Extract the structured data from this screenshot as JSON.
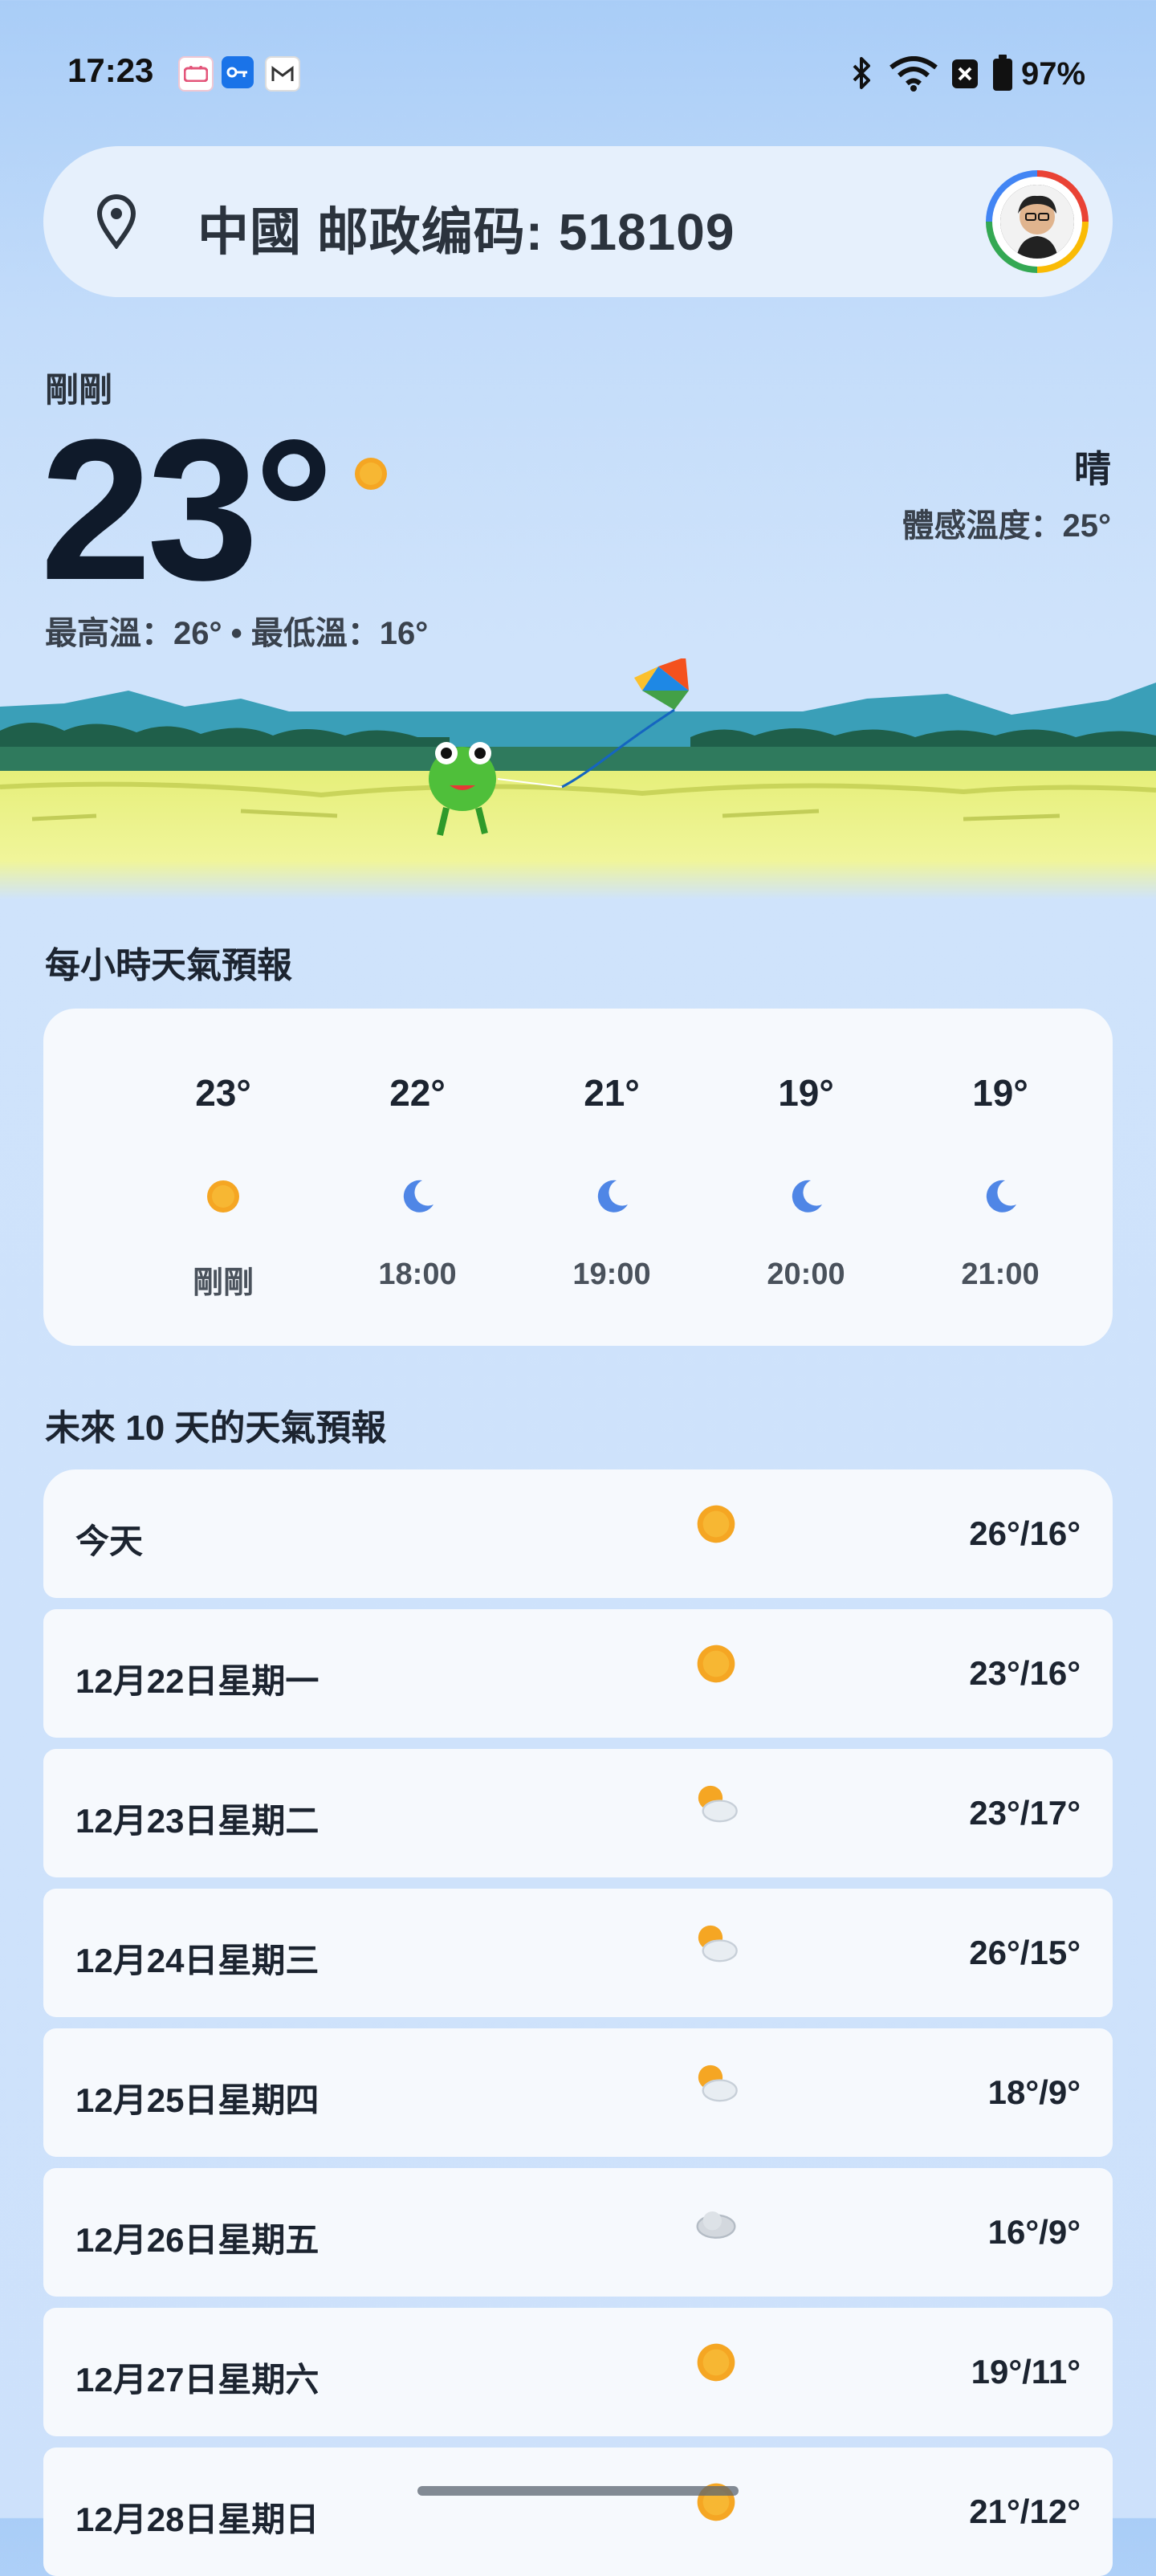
{
  "status_bar": {
    "time": "17:23",
    "notification_icons": [
      "bilibili-icon",
      "key-icon",
      "gmail-icon"
    ],
    "system_icons": [
      "bluetooth-icon",
      "wifi-icon",
      "battery-saver-icon",
      "battery-icon"
    ],
    "battery": "97%"
  },
  "search": {
    "location": "中國 邮政编码: 518109",
    "icon": "location-pin-icon"
  },
  "current": {
    "updated": "剛剛",
    "temp": "23°",
    "hilo": "最高溫：26° • 最低溫：16°",
    "condition": "晴",
    "feels_like": "體感溫度：25°"
  },
  "hourly": {
    "title": "每小時天氣預報",
    "items": [
      {
        "temp": "23°",
        "icon": "sun-icon",
        "label": "剛剛"
      },
      {
        "temp": "22°",
        "icon": "moon-icon",
        "label": "18:00"
      },
      {
        "temp": "21°",
        "icon": "moon-icon",
        "label": "19:00"
      },
      {
        "temp": "19°",
        "icon": "moon-icon",
        "label": "20:00"
      },
      {
        "temp": "19°",
        "icon": "moon-icon",
        "label": "21:00"
      }
    ]
  },
  "daily": {
    "title": "未來 10 天的天氣預報",
    "items": [
      {
        "label": "今天",
        "icon": "sun-icon",
        "temp": "26°/16°"
      },
      {
        "label": "12月22日星期一",
        "icon": "sun-icon",
        "temp": "23°/16°"
      },
      {
        "label": "12月23日星期二",
        "icon": "partly-cloudy-icon",
        "temp": "23°/17°"
      },
      {
        "label": "12月24日星期三",
        "icon": "partly-cloudy-icon",
        "temp": "26°/15°"
      },
      {
        "label": "12月25日星期四",
        "icon": "partly-cloudy-icon",
        "temp": "18°/9°"
      },
      {
        "label": "12月26日星期五",
        "icon": "cloud-icon",
        "temp": "16°/9°"
      },
      {
        "label": "12月27日星期六",
        "icon": "sun-icon",
        "temp": "19°/11°"
      },
      {
        "label": "12月28日星期日",
        "icon": "sun-icon",
        "temp": "21°/12°"
      }
    ]
  },
  "colors": {
    "sun": "#f5a623",
    "moon": "#4f86e6",
    "card": "#f6f9fd",
    "text": "#1c2430"
  }
}
